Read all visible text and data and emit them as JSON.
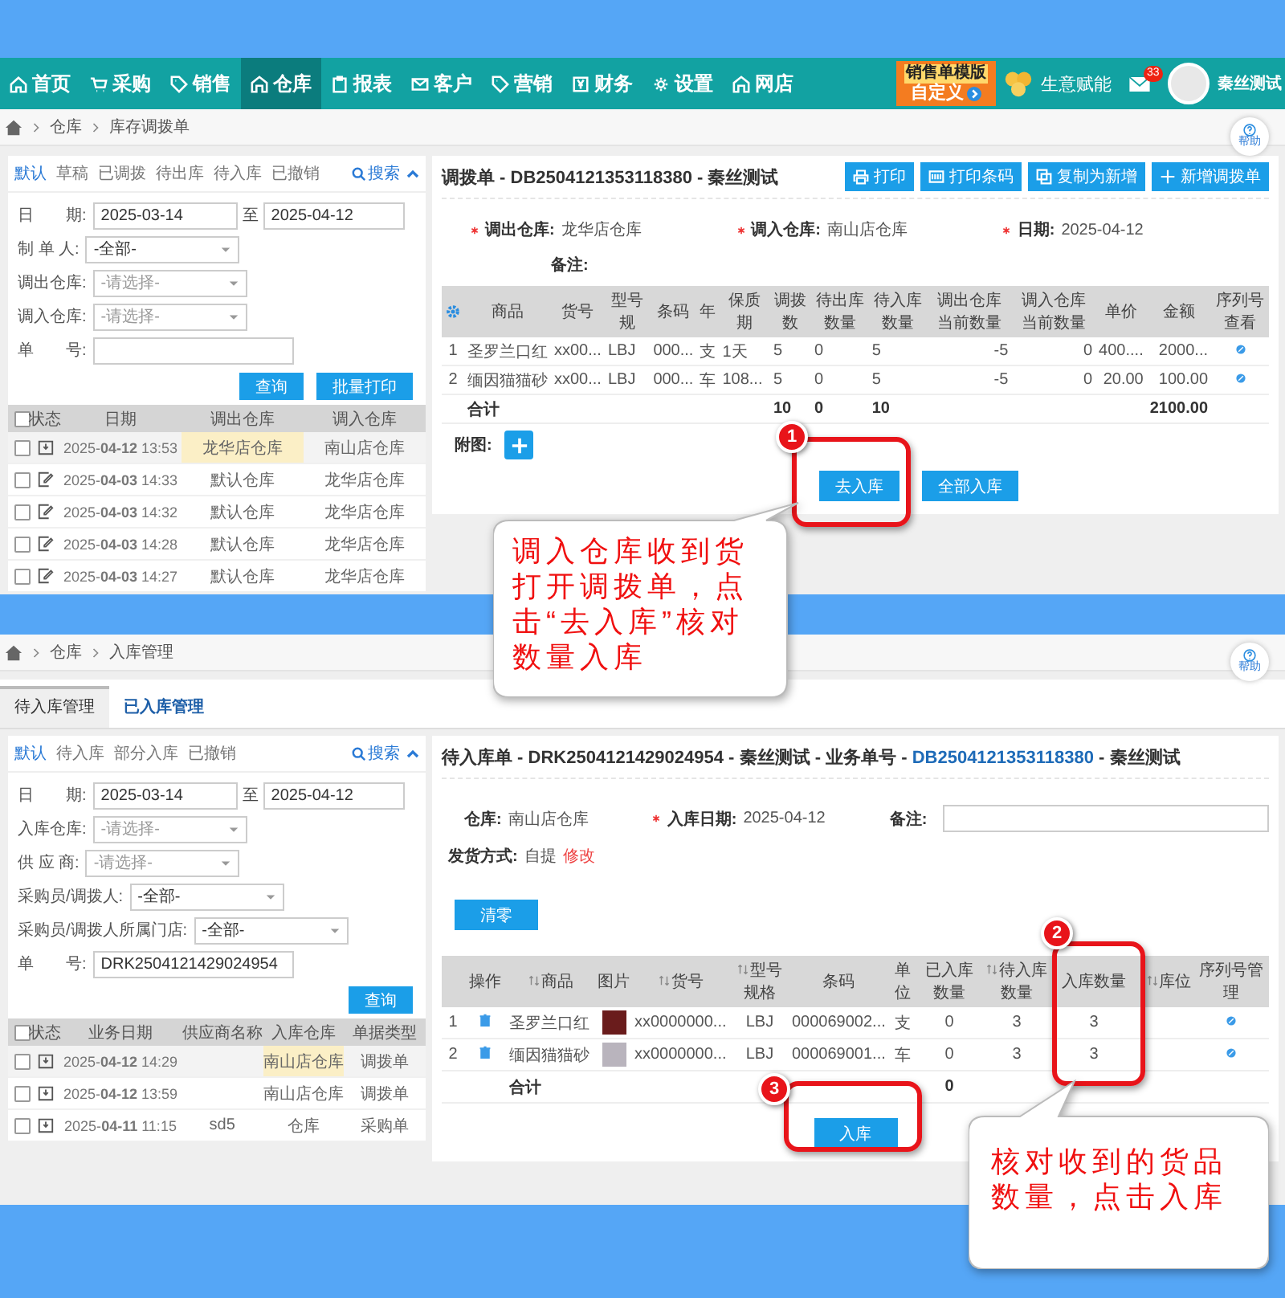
{
  "top": {
    "nav": {
      "items": [
        {
          "label": "首页",
          "selected": false
        },
        {
          "label": "采购",
          "selected": false
        },
        {
          "label": "销售",
          "selected": false
        },
        {
          "label": "仓库",
          "selected": true
        },
        {
          "label": "报表",
          "selected": false
        },
        {
          "label": "客户",
          "selected": false
        },
        {
          "label": "营销",
          "selected": false
        },
        {
          "label": "财务",
          "selected": false
        },
        {
          "label": "设置",
          "selected": false
        },
        {
          "label": "网店",
          "selected": false
        }
      ],
      "promo": [
        "销售单模版",
        "自定义"
      ],
      "empower": "生意赋能",
      "mail_badge": "33",
      "user": "秦丝测试"
    },
    "breadcrumb": [
      "仓库",
      "库存调拨单"
    ],
    "help": "帮助",
    "filter_tabs": [
      {
        "label": "默认",
        "selected": true
      },
      {
        "label": "草稿",
        "selected": false
      },
      {
        "label": "已调拨",
        "selected": false
      },
      {
        "label": "待出库",
        "selected": false
      },
      {
        "label": "待入库",
        "selected": false
      },
      {
        "label": "已撤销",
        "selected": false
      }
    ],
    "search": "搜索",
    "filters": [
      {
        "kind": "range",
        "label": "日　　期:",
        "value": "2025-03-14",
        "to": "至",
        "value_2": "2025-04-12"
      },
      {
        "kind": "select",
        "label": "制 单 人:",
        "value": "-全部-"
      },
      {
        "kind": "select",
        "label": "调出仓库:",
        "placeholder": "-请选择-"
      },
      {
        "kind": "select",
        "label": "调入仓库:",
        "placeholder": "-请选择-"
      },
      {
        "kind": "text",
        "label": "单　　号:"
      }
    ],
    "actions": [
      "查询",
      "批量打印"
    ],
    "list": {
      "checked": false,
      "columns": [
        "状态",
        "日期",
        "调出仓库",
        "调入仓库"
      ],
      "rows": [
        {
          "checked": false,
          "selected": true,
          "kind": "pending",
          "date": "2025-**04-12** 13:53",
          "from": "龙华店仓库",
          "to": "南山店仓库"
        },
        {
          "checked": false,
          "selected": false,
          "kind": "edited",
          "date": "2025-**04-03** 14:33",
          "from": "默认仓库",
          "to": "龙华店仓库"
        },
        {
          "checked": false,
          "selected": false,
          "kind": "edited",
          "date": "2025-**04-03** 14:32",
          "from": "默认仓库",
          "to": "龙华店仓库"
        },
        {
          "checked": false,
          "selected": false,
          "kind": "edited",
          "date": "2025-**04-03** 14:28",
          "from": "默认仓库",
          "to": "龙华店仓库"
        },
        {
          "checked": false,
          "selected": false,
          "kind": "edited",
          "date": "2025-**04-03** 14:27",
          "from": "默认仓库",
          "to": "龙华店仓库"
        }
      ]
    },
    "order": {
      "title": "调拨单 - DB2504121353118380 - 秦丝测试",
      "buttons": [
        "打印",
        "打印条码",
        "复制为新增",
        "新增调拨单"
      ],
      "fields": [
        {
          "label": "调出仓库:",
          "value": "龙华店仓库",
          "required": true
        },
        {
          "label": "调入仓库:",
          "value": "南山店仓库",
          "required": true
        },
        {
          "label": "日期:",
          "value": "2025-04-12",
          "required": true
        }
      ],
      "remark": "备注:",
      "table": {
        "columns": [
          {
            "label": "商品"
          },
          {
            "label": "货号"
          },
          {
            "label": "型号规"
          },
          {
            "label": "条码"
          },
          {
            "label": "年"
          },
          {
            "label": "保质期"
          },
          {
            "label": "调拨数",
            "total": "10"
          },
          {
            "label": "待出库数量",
            "total": "0"
          },
          {
            "label": "待入库数量",
            "total": "10"
          },
          {
            "label": "调出仓库当前数量"
          },
          {
            "label": "调入仓库当前数量"
          },
          {
            "label": "单价"
          },
          {
            "label": "金额",
            "total": "2100.00"
          },
          {
            "label": "序列号查看"
          }
        ],
        "rows": [
          {
            "index": "1",
            "cells": [
              "圣罗兰口红",
              "xx00...",
              "LBJ",
              "000...",
              "支",
              "1天",
              "5",
              "0",
              "5",
              "-5",
              "0",
              "400....",
              "2000..."
            ]
          },
          {
            "index": "2",
            "cells": [
              "缅因猫猫砂",
              "xx00...",
              "LBJ",
              "000...",
              "车",
              "108...",
              "5",
              "0",
              "5",
              "-5",
              "0",
              "20.00",
              "100.00"
            ]
          }
        ],
        "total_label": "合计"
      },
      "attach": "附图:",
      "buttons_bottom": [
        "去入库",
        "全部入库"
      ]
    }
  },
  "bottom": {
    "breadcrumb": [
      "仓库",
      "入库管理"
    ],
    "help": "帮助",
    "tabs": [
      {
        "label": "待入库管理",
        "selected": true
      },
      {
        "label": "已入库管理",
        "selected": false
      }
    ],
    "filter_tabs": [
      {
        "label": "默认",
        "selected": true
      },
      {
        "label": "待入库",
        "selected": false
      },
      {
        "label": "部分入库",
        "selected": false
      },
      {
        "label": "已撤销",
        "selected": false
      }
    ],
    "search": "搜索",
    "filters": [
      {
        "kind": "range",
        "label": "日　　期:",
        "value": "2025-03-14",
        "to": "至",
        "value_2": "2025-04-12"
      },
      {
        "kind": "select",
        "label": "入库仓库:",
        "placeholder": "-请选择-"
      },
      {
        "kind": "select",
        "label": "供 应 商:",
        "placeholder": "-请选择-"
      },
      {
        "kind": "select",
        "label": "采购员/调拨人:",
        "value": "-全部-"
      },
      {
        "kind": "select",
        "label": "采购员/调拨人所属门店:",
        "value": "-全部-"
      },
      {
        "kind": "text",
        "label": "单　　号:",
        "value": "DRK2504121429024954"
      }
    ],
    "query": "查询",
    "list": {
      "checked": false,
      "columns": [
        "状态",
        "业务日期",
        "供应商名称",
        "入库仓库",
        "单据类型"
      ],
      "rows": [
        {
          "checked": false,
          "selected": true,
          "kind": "pending",
          "date": "2025-**04-12** 14:29",
          "warehouse": "南山店仓库",
          "type": "调拨单"
        },
        {
          "checked": false,
          "selected": false,
          "kind": "pending",
          "date": "2025-**04-12** 13:59",
          "warehouse": "南山店仓库",
          "type": "调拨单"
        },
        {
          "checked": false,
          "selected": false,
          "kind": "pending",
          "date": "2025-**04-11** 11:15",
          "supplier": "sd5",
          "warehouse": "仓库",
          "type": "采购单"
        }
      ]
    },
    "order": {
      "title": [
        "待入库单 - DRK2504121429024954 - 秦丝测试 - 业务单号 - ",
        "DB2504121353118380",
        " - 秦丝测试"
      ],
      "warehouse": {
        "label": "仓库:",
        "value": "南山店仓库"
      },
      "date": {
        "label": "入库日期:",
        "value": "2025-04-12",
        "required": true
      },
      "remark": "备注:",
      "shipping": {
        "label": "发货方式:",
        "value": "自提",
        "link": "修改"
      },
      "clear": "清零",
      "columns": [
        {
          "label": "操作",
          "sortable": false
        },
        {
          "label": "商品",
          "sortable": true
        },
        {
          "label": "图片",
          "sortable": false
        },
        {
          "label": "货号",
          "sortable": true
        },
        {
          "label": "型号规格",
          "sortable": true
        },
        {
          "label": "条码",
          "sortable": false
        },
        {
          "label": "单位",
          "sortable": false
        },
        {
          "label": "已入库数量",
          "sortable": false
        },
        {
          "label": "待入库数量",
          "sortable": true
        },
        {
          "label": "入库数量",
          "sortable": false
        },
        {
          "label": "库位",
          "sortable": true
        },
        {
          "label": "序列号管理",
          "sortable": false
        }
      ],
      "rows": [
        {
          "index": "1",
          "product": "圣罗兰口红",
          "item_no": "xx0000000...",
          "model": "LBJ",
          "barcode": "000069002...",
          "unit": "支",
          "received": "0",
          "pending": "3",
          "qty": "3"
        },
        {
          "index": "2",
          "product": "缅因猫猫砂",
          "item_no": "xx0000000...",
          "model": "LBJ",
          "barcode": "000069001...",
          "unit": "车",
          "received": "0",
          "pending": "3",
          "qty": "3"
        }
      ],
      "total_label": "合计",
      "total_received": "0",
      "submit": "入库"
    }
  },
  "annotations": {
    "markers": [
      "1",
      "2",
      "3"
    ],
    "callouts": [
      "调入仓库收到货打开调拨单，点击“去入库”核对数量入库",
      "核对收到的货品数量，点击入库"
    ]
  }
}
